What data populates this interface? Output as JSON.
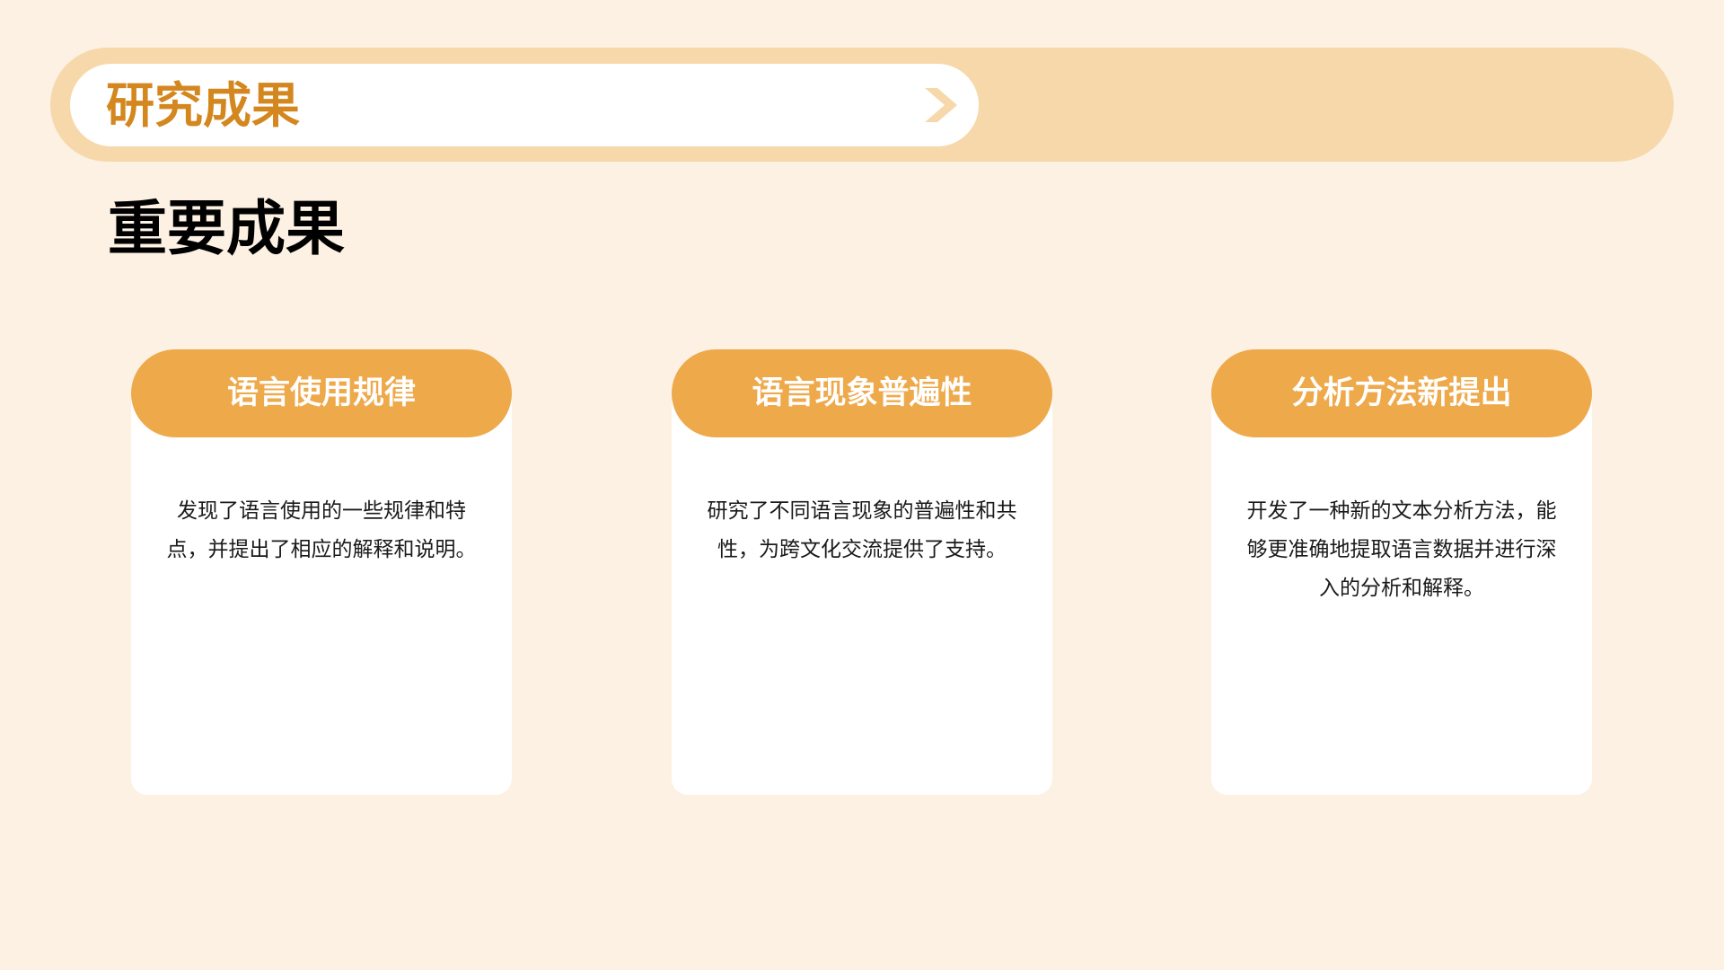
{
  "header": {
    "title": "研究成果"
  },
  "section": {
    "title": "重要成果"
  },
  "cards": [
    {
      "title": "语言使用规律",
      "body": "发现了语言使用的一些规律和特点，并提出了相应的解释和说明。"
    },
    {
      "title": "语言现象普遍性",
      "body": "研究了不同语言现象的普遍性和共性，为跨文化交流提供了支持。"
    },
    {
      "title": "分析方法新提出",
      "body": "开发了一种新的文本分析方法，能够更准确地提取语言数据并进行深入的分析和解释。"
    }
  ],
  "colors": {
    "background": "#fcf1e3",
    "header_bar": "#f7d8aa",
    "accent_title": "#d4871e",
    "card_header": "#eea94b",
    "chevron": "#f7d8aa"
  },
  "icons": {
    "header_chevron": "chevron-right-icon"
  }
}
